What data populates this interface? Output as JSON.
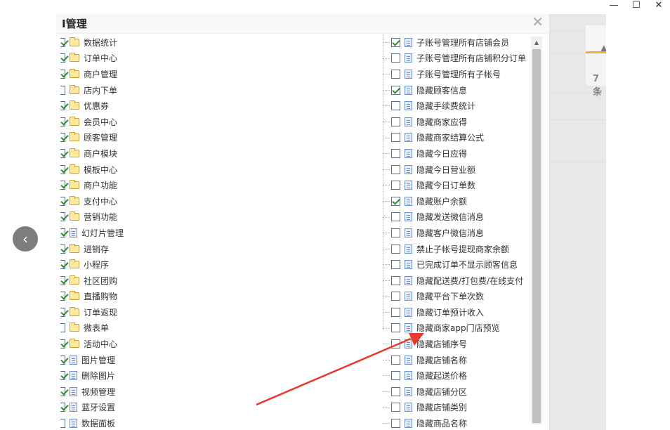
{
  "window_controls": {
    "minimize": "—",
    "maximize": "☐",
    "close": "✕"
  },
  "background": {
    "notification_count": "7条"
  },
  "dialog": {
    "title": "I管理",
    "close_glyph": "✕",
    "left_tree": [
      {
        "label": "数据统计",
        "checked": true,
        "icon": "folder-icon"
      },
      {
        "label": "订单中心",
        "checked": true,
        "icon": "folder-icon"
      },
      {
        "label": "商户管理",
        "checked": true,
        "icon": "folder-icon"
      },
      {
        "label": "店内下单",
        "checked": false,
        "icon": "folder-icon"
      },
      {
        "label": "优惠券",
        "checked": true,
        "icon": "folder-icon"
      },
      {
        "label": "会员中心",
        "checked": true,
        "icon": "folder-icon"
      },
      {
        "label": "顾客管理",
        "checked": true,
        "icon": "folder-icon"
      },
      {
        "label": "商户模块",
        "checked": true,
        "icon": "folder-icon"
      },
      {
        "label": "模板中心",
        "checked": true,
        "icon": "folder-icon"
      },
      {
        "label": "商户功能",
        "checked": true,
        "icon": "folder-icon"
      },
      {
        "label": "支付中心",
        "checked": true,
        "icon": "folder-icon"
      },
      {
        "label": "营销功能",
        "checked": true,
        "icon": "folder-icon"
      },
      {
        "label": "幻灯片管理",
        "checked": true,
        "icon": "page-icon"
      },
      {
        "label": "进销存",
        "checked": true,
        "icon": "folder-icon"
      },
      {
        "label": "小程序",
        "checked": true,
        "icon": "folder-icon"
      },
      {
        "label": "社区团购",
        "checked": true,
        "icon": "folder-icon"
      },
      {
        "label": "直播购物",
        "checked": true,
        "icon": "folder-icon"
      },
      {
        "label": "订单返现",
        "checked": true,
        "icon": "folder-icon"
      },
      {
        "label": "微表单",
        "checked": false,
        "icon": "folder-icon"
      },
      {
        "label": "活动中心",
        "checked": true,
        "icon": "folder-icon"
      },
      {
        "label": "图片管理",
        "checked": true,
        "icon": "page-icon"
      },
      {
        "label": "删除图片",
        "checked": true,
        "icon": "page-icon"
      },
      {
        "label": "视频管理",
        "checked": true,
        "icon": "page-icon"
      },
      {
        "label": "蓝牙设置",
        "checked": true,
        "icon": "page-icon"
      },
      {
        "label": "数据面板",
        "checked": false,
        "icon": "page-icon"
      }
    ],
    "right_tree": [
      {
        "label": "子账号管理所有店铺会员",
        "checked": true
      },
      {
        "label": "子账号管理所有店铺积分订单",
        "checked": false
      },
      {
        "label": "子账号管理所有子帐号",
        "checked": false
      },
      {
        "label": "隐藏顾客信息",
        "checked": true
      },
      {
        "label": "隐藏手续费统计",
        "checked": false
      },
      {
        "label": "隐藏商家应得",
        "checked": false
      },
      {
        "label": "隐藏商家结算公式",
        "checked": false
      },
      {
        "label": "隐藏今日应得",
        "checked": false
      },
      {
        "label": "隐藏今日营业额",
        "checked": false
      },
      {
        "label": "隐藏今日订单数",
        "checked": false
      },
      {
        "label": "隐藏账户余额",
        "checked": true
      },
      {
        "label": "隐藏发送微信消息",
        "checked": false
      },
      {
        "label": "隐藏客户微信消息",
        "checked": false
      },
      {
        "label": "禁止子帐号提现商家余额",
        "checked": false
      },
      {
        "label": "已完成订单不显示顾客信息",
        "checked": false
      },
      {
        "label": "隐藏配送费/打包费/在线支付",
        "checked": false
      },
      {
        "label": "隐藏平台下单次数",
        "checked": false
      },
      {
        "label": "隐藏订单预计收入",
        "checked": false
      },
      {
        "label": "隐藏商家app门店预览",
        "checked": false
      },
      {
        "label": "隐藏店铺序号",
        "checked": false
      },
      {
        "label": "隐藏店铺名称",
        "checked": false
      },
      {
        "label": "隐藏起送价格",
        "checked": false
      },
      {
        "label": "隐藏店铺分区",
        "checked": false
      },
      {
        "label": "隐藏店铺类别",
        "checked": false
      },
      {
        "label": "隐藏商品名称",
        "checked": false
      }
    ]
  },
  "annotation": {
    "color": "#e8392f",
    "points_to": "隐藏商家app门店预览"
  },
  "nav": {
    "prev_glyph": "‹"
  }
}
